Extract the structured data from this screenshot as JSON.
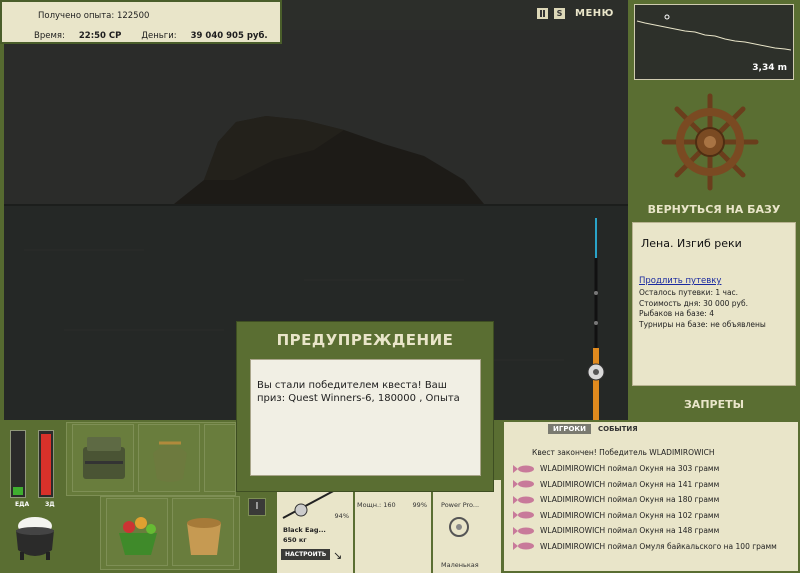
{
  "hud": {
    "exp_label": "Получено опыта: 122500",
    "time_label": "Время:",
    "time_value": "22:50 СР",
    "money_label": "Деньги:",
    "money_value": "39 040 905 руб."
  },
  "toolbar": {
    "pause_icon": "pause-icon",
    "s_label": "S",
    "menu_label": "МЕНЮ"
  },
  "map": {
    "depth": "3,34 m"
  },
  "right": {
    "back_to_base": "ВЕРНУТЬСЯ НА БАЗУ",
    "location": "Лена. Изгиб реки",
    "extend_link": "Продлить путевку",
    "lines": [
      "Осталось путевки: 1 час.",
      "Стоимость дня: 30 000 руб.",
      "Рыбаков на базе: 4",
      "Турниры на базе: не объявлены"
    ],
    "bans": "ЗАПРЕТЫ"
  },
  "status": {
    "food_label": "ЕДА",
    "health_label": "ЗД",
    "food_level": 0.12,
    "health_level": 0.93
  },
  "dialog": {
    "title": "ПРЕДУПРЕЖДЕНИЕ",
    "message": "Вы стали победителем квеста! Ваш приз: Quest Winners-6, 180000 , Опыта"
  },
  "equipment": {
    "rod_name": "Black Eag...",
    "rod_weight": "650 кг",
    "rod_pct": "94%",
    "reel_label": "Мощн.: 160",
    "reel_pct": "99%",
    "line_label": "Power Pro...",
    "hook_label": "Маленькая",
    "configure_button": "НАСТРОИТЬ",
    "toggle_label": "I"
  },
  "events": {
    "tab_players": "ИГРОКИ",
    "tab_events": "СОБЫТИЯ",
    "items": [
      "Квест закончен! Победитель WLADIMIROWICH",
      "WLADIMIROWICH поймал Окуня на 303 грамм",
      "WLADIMIROWICH поймал Окуня на 141 грамм",
      "WLADIMIROWICH поймал Окуня на 180 грамм",
      "WLADIMIROWICH поймал Окуня на 102 грамм",
      "WLADIMIROWICH поймал Окуня на 148 грамм",
      "WLADIMIROWICH поймал Омуля байкальского на 100 грамм"
    ]
  },
  "colors": {
    "panel": "#5a6e32",
    "cream": "#e9e5c9",
    "food": "#3fae2f",
    "health": "#d8312a"
  }
}
